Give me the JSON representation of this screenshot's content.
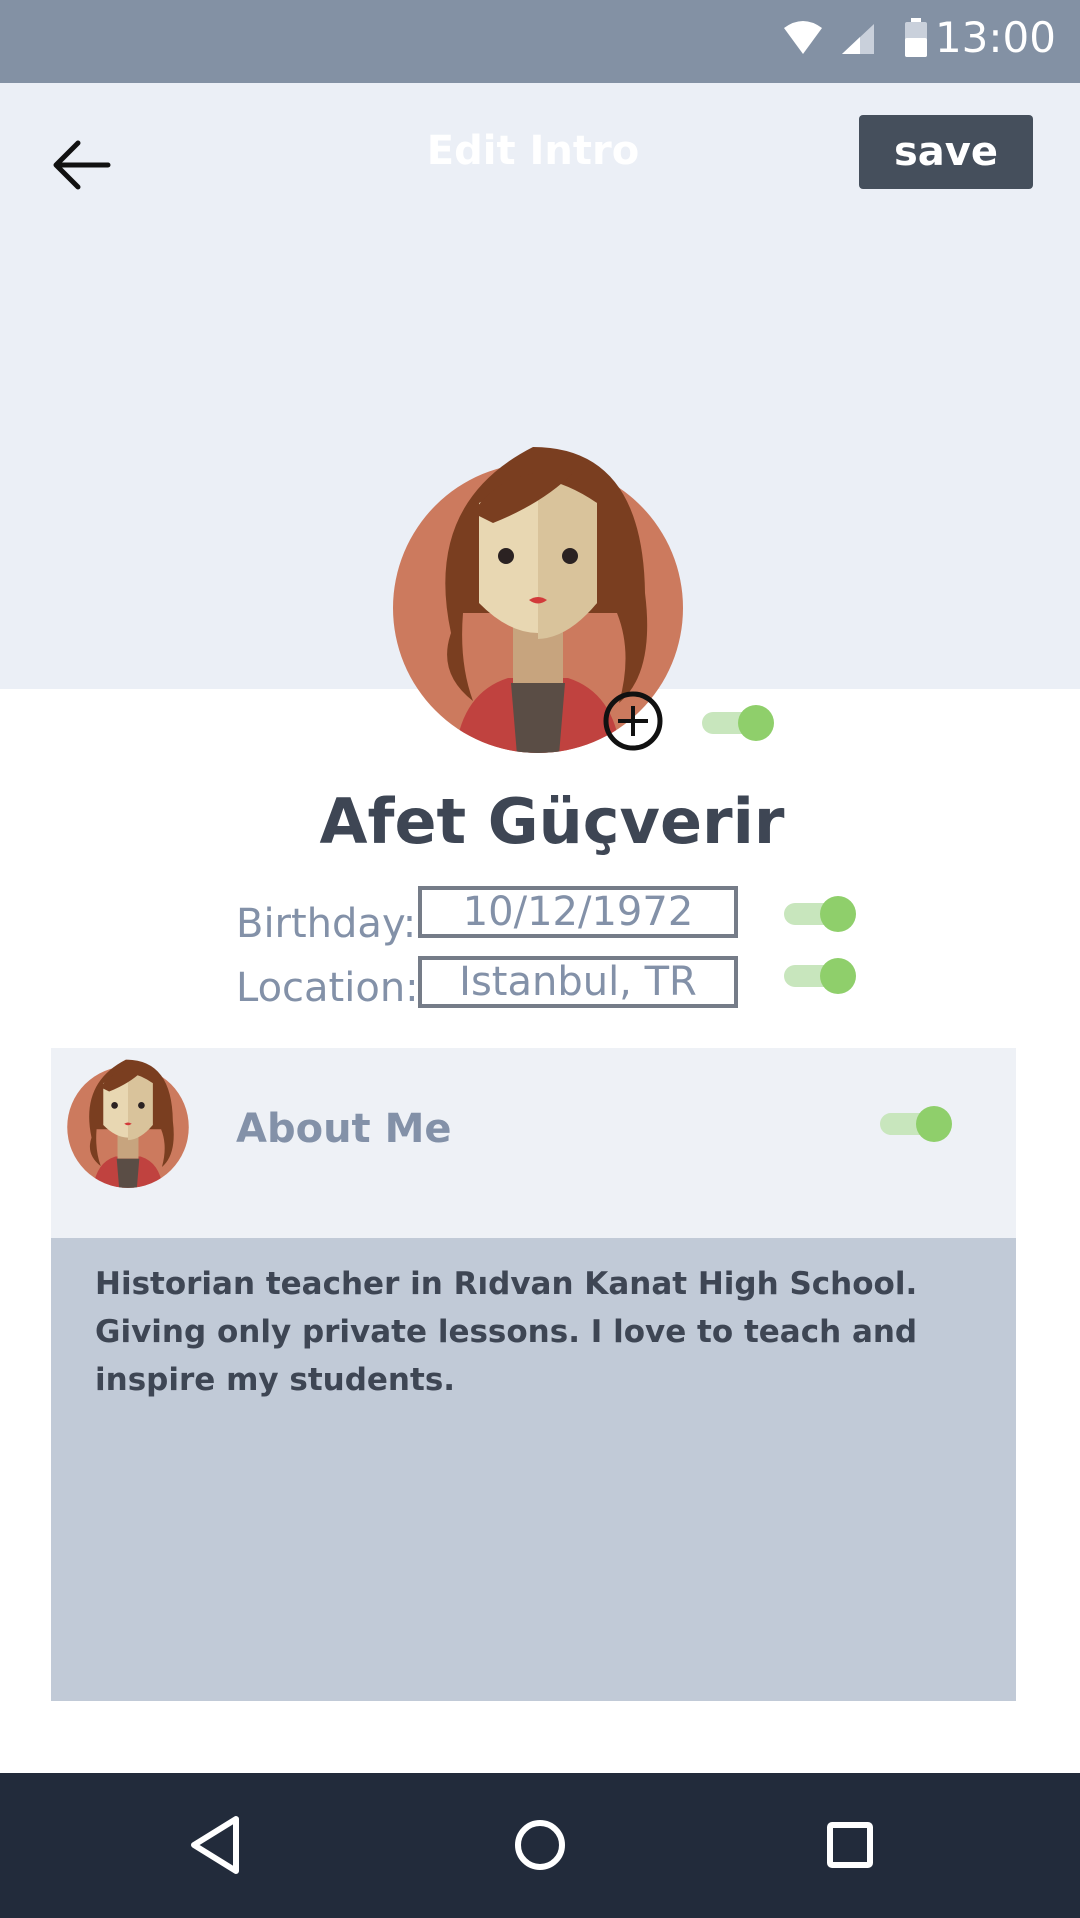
{
  "status_bar": {
    "time": "13:00",
    "icons": [
      "wifi-icon",
      "signal-icon",
      "battery-icon"
    ]
  },
  "header": {
    "title": "Edit Intro",
    "back_icon": "arrow-left-icon",
    "save_label": "save"
  },
  "profile": {
    "name": "Afet Güçverir",
    "avatar_icon": "woman-avatar",
    "add_photo_icon": "plus-circle-icon",
    "photo_visible": true
  },
  "fields": {
    "birthday": {
      "label": "Birthday:",
      "value": "10/12/1972",
      "visible": true
    },
    "location": {
      "label": "Location:",
      "value": "Istanbul, TR",
      "visible": true
    }
  },
  "about": {
    "title": "About Me",
    "text": "Historian teacher in Rıdvan Kanat High School. Giving only private lessons. I love to teach and inspire my students.",
    "visible": true
  },
  "nav_bar": {
    "icons": [
      "back-triangle-icon",
      "home-circle-icon",
      "recents-square-icon"
    ]
  },
  "colors": {
    "status_bar": "#8391a4",
    "header_bg": "#ebeff6",
    "save_button": "#454f5c",
    "toggle_on": "#8fcf6b",
    "about_body": "#c1cad7",
    "nav_bar": "#222b3b"
  }
}
